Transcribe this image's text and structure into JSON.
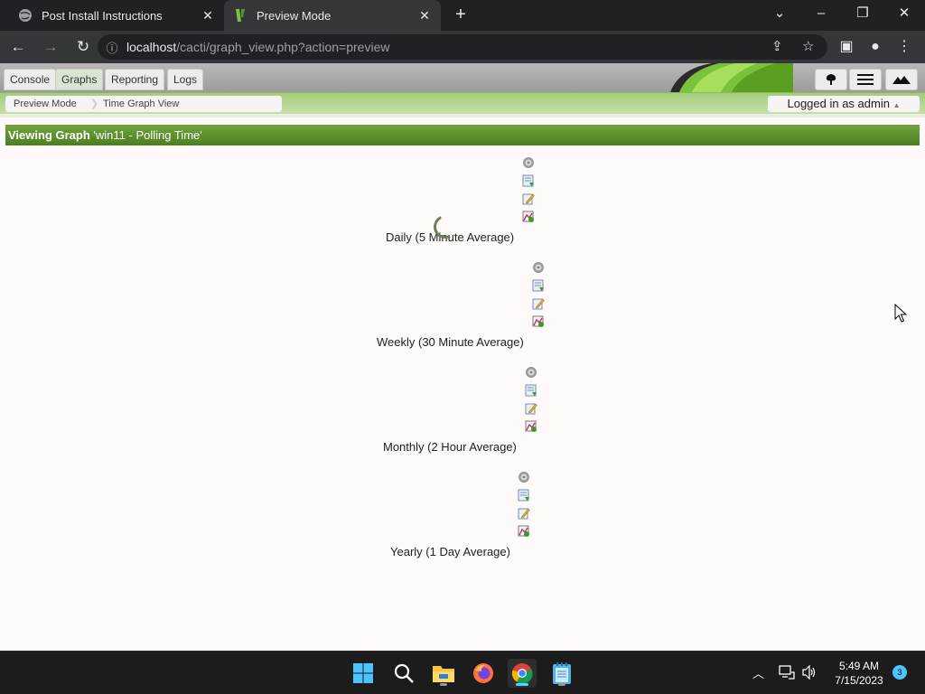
{
  "browser": {
    "tabs": [
      {
        "title": "Post Install Instructions",
        "active": false
      },
      {
        "title": "Preview Mode",
        "active": true
      }
    ],
    "url_host": "localhost",
    "url_path": "/cacti/graph_view.php?action=preview"
  },
  "app": {
    "nav_tabs": [
      "Console",
      "Graphs",
      "Reporting",
      "Logs"
    ],
    "active_tab": "Graphs",
    "breadcrumbs": [
      "Preview Mode",
      "Time Graph View"
    ],
    "login_status": "Logged in as admin",
    "title_bold": "Viewing Graph",
    "title_rest": "'win11 - Polling Time'",
    "graphs": [
      {
        "label": "Daily (5 Minute Average)"
      },
      {
        "label": "Weekly (30 Minute Average)"
      },
      {
        "label": "Monthly (2 Hour Average)"
      },
      {
        "label": "Yearly (1 Day Average)"
      }
    ]
  },
  "taskbar": {
    "time": "5:49 AM",
    "date": "7/15/2023",
    "notification_count": "3"
  },
  "colors": {
    "accent_green": "#5a8f2c",
    "page_bg": "#fffafa",
    "chrome_dark": "#202124"
  }
}
